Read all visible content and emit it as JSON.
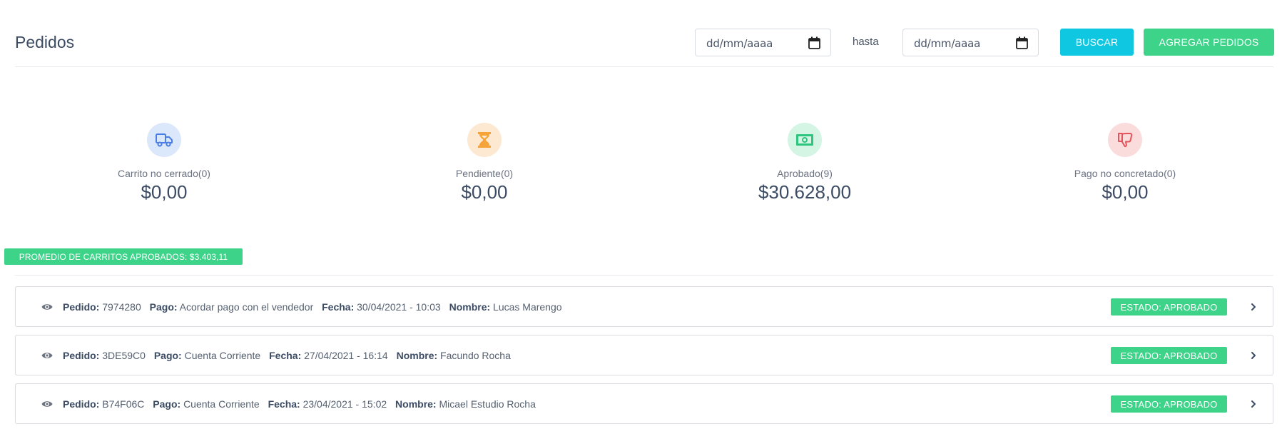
{
  "header": {
    "title": "Pedidos",
    "date_from_placeholder": "dd/mm/aaaa",
    "hasta": "hasta",
    "date_to_placeholder": "dd/mm/aaaa",
    "buscar_label": "BUSCAR",
    "agregar_label": "AGREGAR PEDIDOS"
  },
  "stats": [
    {
      "label": "Carrito no cerrado(0)",
      "value": "$0,00",
      "icon": "truck-icon",
      "color": "#4a7ee6",
      "bg": "#dbe7fb"
    },
    {
      "label": "Pendiente(0)",
      "value": "$0,00",
      "icon": "hourglass-icon",
      "color": "#f6a43a",
      "bg": "#fde9d2"
    },
    {
      "label": "Aprobado(9)",
      "value": "$30.628,00",
      "icon": "money-icon",
      "color": "#2ec57f",
      "bg": "#d4f5e4"
    },
    {
      "label": "Pago no concretado(0)",
      "value": "$0,00",
      "icon": "thumbs-down-icon",
      "color": "#e5545a",
      "bg": "#fadcdd"
    }
  ],
  "promedio": "PROMEDIO DE CARRITOS APROBADOS: $3.403,11",
  "field_labels": {
    "pedido": "Pedido:",
    "pago": "Pago:",
    "fecha": "Fecha:",
    "nombre": "Nombre:"
  },
  "orders": [
    {
      "pedido": "7974280",
      "pago": "Acordar pago con el vendedor",
      "fecha": "30/04/2021 - 10:03",
      "nombre": "Lucas Marengo",
      "estado": "ESTADO: APROBADO"
    },
    {
      "pedido": "3DE59C0",
      "pago": "Cuenta Corriente",
      "fecha": "27/04/2021 - 16:14",
      "nombre": "Facundo Rocha",
      "estado": "ESTADO: APROBADO"
    },
    {
      "pedido": "B74F06C",
      "pago": "Cuenta Corriente",
      "fecha": "23/04/2021 - 15:02",
      "nombre": "Micael Estudio Rocha",
      "estado": "ESTADO: APROBADO"
    }
  ],
  "colors": {
    "accent_cyan": "#0fc7e0",
    "accent_green": "#3dd48a"
  }
}
